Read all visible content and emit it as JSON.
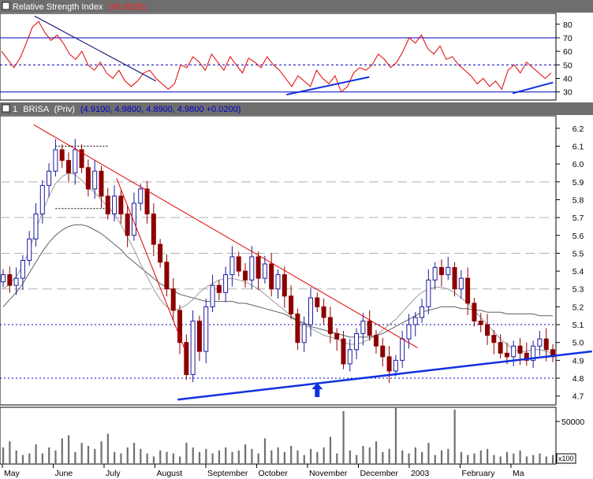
{
  "colors": {
    "background": "#ffffff",
    "title_bar": "#6e6e6e",
    "title_text": "#ffffff",
    "rsi_value": "#ff2020",
    "price_value": "#0000cc",
    "rsi_line": "#e00000",
    "up_candle": "#1a1aa0",
    "down_candle": "#8c0000",
    "ma_fast": "#9a9a9a",
    "ma_slow": "#606060",
    "trend_red": "#e00000",
    "trend_blue": "#1030e0",
    "level_blue": "#0000c0",
    "grid_dash": "#b0b0b0",
    "volume_bar": "#707070"
  },
  "icons": {
    "panel_marker": "square-icon",
    "signal": "up-arrow-icon"
  },
  "chart_data": [
    {
      "type": "line",
      "panel": "rsi",
      "title": "Relative Strength Index",
      "title_value": "(45.5926)",
      "ylim": [
        24,
        88
      ],
      "yticks": [
        "30",
        "40",
        "50",
        "60",
        "70",
        "80"
      ],
      "levels": [
        30,
        50,
        70
      ],
      "grid": false,
      "series": [
        {
          "values": [
            60,
            54,
            48,
            55,
            66,
            78,
            82,
            74,
            68,
            72,
            66,
            58,
            54,
            60,
            50,
            46,
            52,
            44,
            40,
            46,
            38,
            34,
            38,
            44,
            46,
            40,
            36,
            32,
            36,
            50,
            48,
            56,
            52,
            46,
            58,
            52,
            46,
            56,
            50,
            44,
            55,
            52,
            48,
            56,
            50,
            46,
            40,
            34,
            42,
            38,
            34,
            46,
            40,
            36,
            42,
            30,
            34,
            44,
            48,
            46,
            50,
            58,
            54,
            48,
            52,
            60,
            70,
            66,
            72,
            62,
            58,
            64,
            54,
            56,
            50,
            46,
            42,
            36,
            40,
            34,
            38,
            32,
            46,
            50,
            44,
            52,
            48,
            44,
            40,
            44
          ]
        }
      ],
      "trendlines": [
        {
          "from": [
            18,
            86
          ],
          "to": [
            84,
            38
          ]
        },
        {
          "from": [
            155,
            28
          ],
          "to": [
            200,
            41
          ]
        },
        {
          "from": [
            278,
            29
          ],
          "to": [
            300,
            37
          ]
        }
      ]
    },
    {
      "type": "candlestick",
      "panel": "price",
      "title_prefix": "1",
      "symbol": "BRISA",
      "symbol_note": "(Priv)",
      "ohlc_text": "(4.9100, 4.9800, 4.8900, 4.9800 +0.0200)",
      "ylim": [
        4.65,
        6.27
      ],
      "yticks": [
        "4.7",
        "4.8",
        "4.9",
        "5.0",
        "5.1",
        "5.2",
        "5.3",
        "5.4",
        "5.5",
        "5.6",
        "5.7",
        "5.8",
        "5.9",
        "6.0",
        "6.1",
        "6.2"
      ],
      "dashed_levels": [
        5.9,
        5.7,
        5.5,
        5.3
      ],
      "dotted_levels": [
        4.8,
        5.1
      ],
      "grid": false,
      "close": [
        5.38,
        5.32,
        5.36,
        5.46,
        5.58,
        5.72,
        5.88,
        5.96,
        6.08,
        6.02,
        5.95,
        6.08,
        5.98,
        5.86,
        5.96,
        5.82,
        5.72,
        5.82,
        5.72,
        5.6,
        5.78,
        5.86,
        5.72,
        5.55,
        5.45,
        5.3,
        5.18,
        5.0,
        4.82,
        5.12,
        4.95,
        5.2,
        5.32,
        5.28,
        5.38,
        5.48,
        5.4,
        5.35,
        5.48,
        5.36,
        5.44,
        5.3,
        5.38,
        5.26,
        5.16,
        5.0,
        5.1,
        5.25,
        5.2,
        5.14,
        5.05,
        5.02,
        4.88,
        4.96,
        5.05,
        5.12,
        5.04,
        4.98,
        4.92,
        4.84,
        4.9,
        5.02,
        5.1,
        5.14,
        5.2,
        5.35,
        5.42,
        5.38,
        5.42,
        5.3,
        5.36,
        5.22,
        5.12,
        5.1,
        5.04,
        5.0,
        4.94,
        4.92,
        4.98,
        4.94,
        4.9,
        4.98,
        5.02,
        4.96,
        4.92
      ],
      "ma_fast": [
        5.3,
        5.33,
        5.37,
        5.43,
        5.52,
        5.63,
        5.73,
        5.82,
        5.89,
        5.93,
        5.95,
        5.94,
        5.91,
        5.87,
        5.84,
        5.8,
        5.76,
        5.72,
        5.66,
        5.59,
        5.52,
        5.44,
        5.37,
        5.3,
        5.24,
        5.2,
        5.18,
        5.19,
        5.21,
        5.24,
        5.28,
        5.31,
        5.33,
        5.35,
        5.36,
        5.36,
        5.35,
        5.34,
        5.32,
        5.3,
        5.27,
        5.24,
        5.21,
        5.18,
        5.15,
        5.12,
        5.1,
        5.08,
        5.06,
        5.04,
        5.03,
        5.02,
        5.0,
        4.99,
        4.99,
        5.0,
        5.02,
        5.04,
        5.07,
        5.1,
        5.13,
        5.17,
        5.21,
        5.25,
        5.28,
        5.3,
        5.31,
        5.31,
        5.3,
        5.28,
        5.25,
        5.22,
        5.18,
        5.14,
        5.1,
        5.06,
        5.02,
        4.99,
        4.96,
        4.95,
        4.95,
        4.96,
        4.96,
        4.95,
        4.94
      ],
      "ma_slow": [
        5.2,
        5.24,
        5.28,
        5.33,
        5.39,
        5.45,
        5.51,
        5.56,
        5.6,
        5.63,
        5.65,
        5.66,
        5.66,
        5.65,
        5.63,
        5.61,
        5.58,
        5.55,
        5.52,
        5.48,
        5.45,
        5.42,
        5.39,
        5.36,
        5.33,
        5.31,
        5.29,
        5.27,
        5.26,
        5.25,
        5.24,
        5.23,
        5.23,
        5.23,
        5.23,
        5.23,
        5.22,
        5.22,
        5.21,
        5.2,
        5.19,
        5.18,
        5.17,
        5.16,
        5.14,
        5.12,
        5.11,
        5.09,
        5.08,
        5.07,
        5.06,
        5.05,
        5.04,
        5.03,
        5.03,
        5.03,
        5.03,
        5.04,
        5.05,
        5.07,
        5.09,
        5.11,
        5.13,
        5.15,
        5.17,
        5.18,
        5.19,
        5.2,
        5.2,
        5.2,
        5.19,
        5.19,
        5.18,
        5.18,
        5.17,
        5.17,
        5.17,
        5.16,
        5.16,
        5.16,
        5.16,
        5.16,
        5.15,
        5.15,
        5.15
      ],
      "red_trend": {
        "from": [
          14,
          6.22
        ],
        "to": [
          190,
          4.97
        ]
      },
      "red_trend_steep": {
        "from": [
          52,
          5.92
        ],
        "to": [
          83,
          4.97
        ]
      },
      "blue_trend": {
        "from": [
          80,
          4.68
        ],
        "to": [
          270,
          4.95
        ]
      },
      "horizontal_marks": [
        6.1,
        5.75
      ],
      "signal_arrow_at": 144
    },
    {
      "type": "bar",
      "panel": "volume",
      "ylim": [
        0,
        75000
      ],
      "yticks": [
        "50000"
      ],
      "unit_label": "x100",
      "values": [
        22,
        30,
        18,
        12,
        14,
        26,
        14,
        22,
        18,
        34,
        38,
        16,
        28,
        24,
        20,
        30,
        40,
        16,
        14,
        22,
        28,
        20,
        14,
        10,
        18,
        16,
        14,
        10,
        28,
        22,
        16,
        20,
        14,
        18,
        22,
        16,
        18,
        26,
        20,
        14,
        34,
        18,
        22,
        16,
        24,
        18,
        12,
        20,
        16,
        22,
        36,
        14,
        70,
        18,
        12,
        24,
        22,
        30,
        16,
        20,
        74,
        18,
        14,
        22,
        16,
        28,
        12,
        18,
        20,
        72,
        16,
        12,
        14,
        18,
        20,
        12,
        10,
        16,
        14,
        18,
        10,
        12,
        14,
        10,
        12
      ]
    }
  ],
  "x_axis": {
    "labels": [
      "May",
      "June",
      "July",
      "August",
      "September",
      "October",
      "November",
      "December",
      "2003",
      "February",
      "Ma"
    ]
  }
}
